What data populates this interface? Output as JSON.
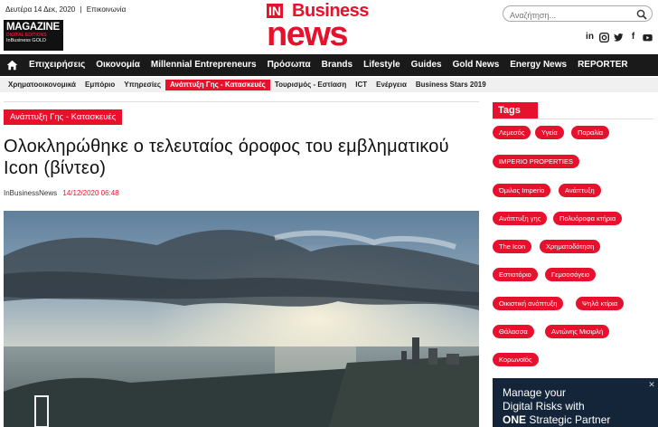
{
  "top": {
    "date": "Δευτέρα 14 Δεκ, 2020",
    "separator": "|",
    "contact": "Επικοινωνία"
  },
  "magazine_logo": {
    "title": "MAGAZINE",
    "line2": "DIGITAL EDITIONS",
    "line3": "InBusiness GOLD"
  },
  "brand": {
    "in": "IN",
    "business": "Business",
    "news": "news"
  },
  "search": {
    "placeholder": "Αναζήτηση..."
  },
  "socials": [
    "in",
    "ig",
    "t",
    "f",
    "yt"
  ],
  "main_nav": [
    "Επιχειρήσεις",
    "Οικονομία",
    "Millennial Entrepreneurs",
    "Πρόσωπα",
    "Brands",
    "Lifestyle",
    "Guides",
    "Gold News",
    "Energy News",
    "REPORTER"
  ],
  "sub_nav": [
    "Χρηματοοικονομικά",
    "Εμπόριο",
    "Υπηρεσίες",
    "Ανάπτυξη Γης - Κατασκευές",
    "Τουρισμός - Εστίαση",
    "ICT",
    "Ενέργεια",
    "Business Stars 2019"
  ],
  "article": {
    "category": "Ανάπτυξη Γης - Κατασκευές",
    "title": "Ολοκληρώθηκε ο τελευταίος όροφος του εμβληματικού Icon (βίντεο)",
    "author": "InBusinessNews",
    "date": "14/12/2020 06:48"
  },
  "sidebar": {
    "tags_title": "Tags",
    "tags": [
      "Λεμεσός",
      "Υγεία",
      "Παραλία",
      "IMPERIO PROPERTIES",
      "Όμιλος Imperio",
      "Ανάπτυξη",
      "Ανάπτυξη γης",
      "Πολυόροφα κτήρια",
      "The Icon",
      "Χρηματοδότηση",
      "Εστιατόριο",
      "Γεμσοσόγειο",
      "Οικιστική ανάπτυξη",
      "Ψηλά κτίρια",
      "Θάλασσα",
      "Αντώνης Μισιρλή",
      "Κορωνοϊός"
    ]
  },
  "ad": {
    "line1": "Manage your",
    "line2": "Digital Risks with",
    "line3_bold": "ONE",
    "line3_rest": "Strategic Partner"
  },
  "colors": {
    "accent": "#e8112d",
    "nav_bg": "#1a1a1a",
    "subnav_bg": "#f0f0f0",
    "ad_bg": "#14253a"
  }
}
